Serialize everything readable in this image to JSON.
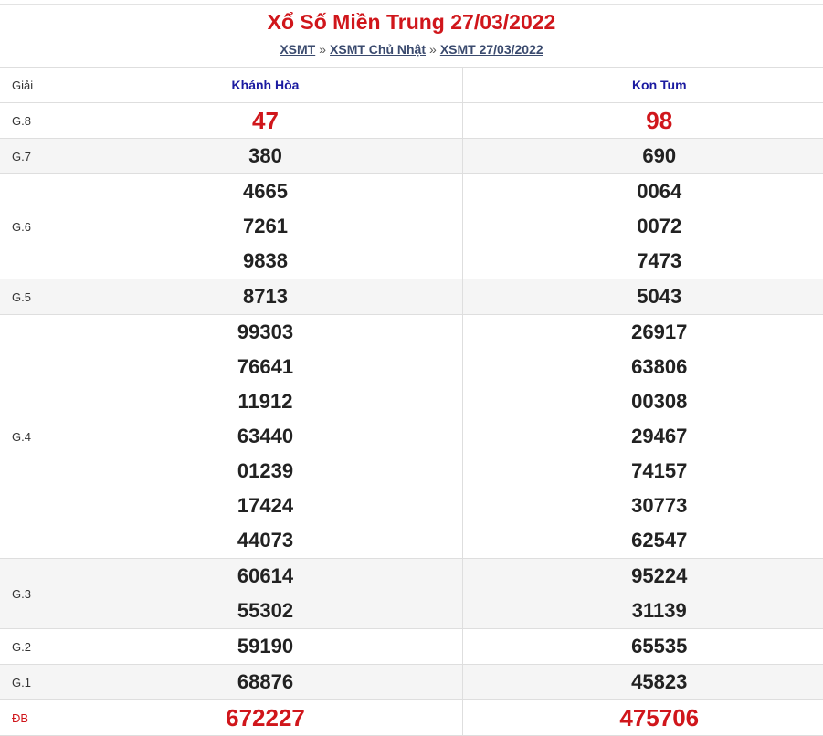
{
  "title": "Xổ Số Miền Trung 27/03/2022",
  "breadcrumb": {
    "items": [
      "XSMT",
      "XSMT Chủ Nhật",
      "XSMT 27/03/2022"
    ],
    "separator": "»"
  },
  "colors": {
    "title": "#d0161b",
    "province_header": "#1a1aa0",
    "highlight_number": "#d0161b",
    "row_shade": "#f5f5f5"
  },
  "table": {
    "header_label": "Giải",
    "provinces": [
      "Khánh Hòa",
      "Kon Tum"
    ],
    "rows": [
      {
        "tier": "G.8",
        "shaded": false,
        "red": true,
        "values": [
          [
            "47"
          ],
          [
            "98"
          ]
        ]
      },
      {
        "tier": "G.7",
        "shaded": true,
        "red": false,
        "values": [
          [
            "380"
          ],
          [
            "690"
          ]
        ]
      },
      {
        "tier": "G.6",
        "shaded": false,
        "red": false,
        "values": [
          [
            "4665",
            "7261",
            "9838"
          ],
          [
            "0064",
            "0072",
            "7473"
          ]
        ]
      },
      {
        "tier": "G.5",
        "shaded": true,
        "red": false,
        "values": [
          [
            "8713"
          ],
          [
            "5043"
          ]
        ]
      },
      {
        "tier": "G.4",
        "shaded": false,
        "red": false,
        "values": [
          [
            "99303",
            "76641",
            "11912",
            "63440",
            "01239",
            "17424",
            "44073"
          ],
          [
            "26917",
            "63806",
            "00308",
            "29467",
            "74157",
            "30773",
            "62547"
          ]
        ]
      },
      {
        "tier": "G.3",
        "shaded": true,
        "red": false,
        "values": [
          [
            "60614",
            "55302"
          ],
          [
            "95224",
            "31139"
          ]
        ]
      },
      {
        "tier": "G.2",
        "shaded": false,
        "red": false,
        "values": [
          [
            "59190"
          ],
          [
            "65535"
          ]
        ]
      },
      {
        "tier": "G.1",
        "shaded": true,
        "red": false,
        "values": [
          [
            "68876"
          ],
          [
            "45823"
          ]
        ]
      },
      {
        "tier": "ĐB",
        "shaded": false,
        "red": true,
        "values": [
          [
            "672227"
          ],
          [
            "475706"
          ]
        ]
      }
    ]
  }
}
